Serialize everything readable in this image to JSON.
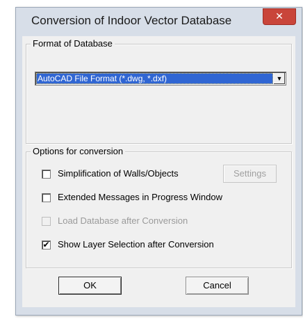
{
  "window": {
    "title": "Conversion of Indoor Vector Database",
    "close_glyph": "✕"
  },
  "format_group": {
    "legend": "Format of Database",
    "selected": "AutoCAD File Format (*.dwg, *.dxf)",
    "arrow_icon": "chevron-down-icon",
    "arrow_glyph": "▼"
  },
  "options_group": {
    "legend": "Options for conversion",
    "options": [
      {
        "label": "Simplification of Walls/Objects",
        "checked": false,
        "enabled": true
      },
      {
        "label": "Extended Messages in Progress Window",
        "checked": false,
        "enabled": true
      },
      {
        "label": "Load Database after Conversion",
        "checked": false,
        "enabled": false
      },
      {
        "label": "Show Layer Selection after Conversion",
        "checked": true,
        "enabled": true
      }
    ],
    "settings_label": "Settings",
    "settings_enabled": false,
    "check_glyph": "✔"
  },
  "buttons": {
    "ok_label": "OK",
    "cancel_label": "Cancel"
  },
  "colors": {
    "selection": "#3066d3",
    "close": "#c9453a",
    "dialog_bg": "#f0f0f0",
    "frame": "#d7dee8"
  }
}
